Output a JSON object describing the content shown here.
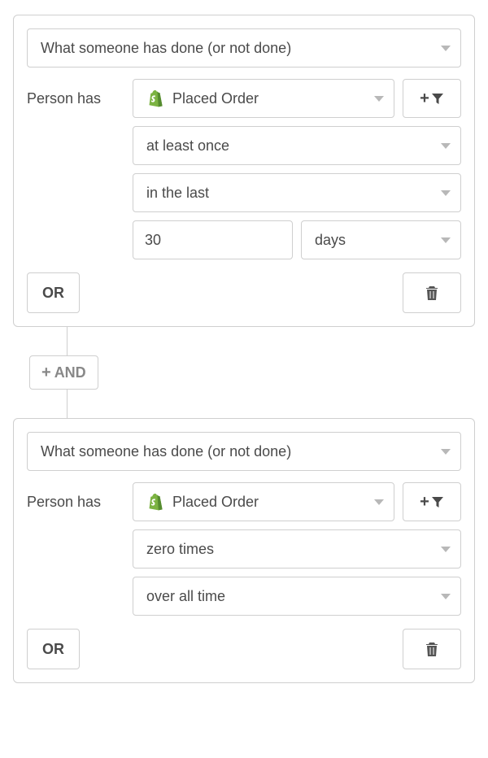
{
  "conditions": [
    {
      "type_label": "What someone has done (or not done)",
      "prefix": "Person has",
      "event": "Placed Order",
      "frequency": "at least once",
      "time_range": "in the last",
      "value": "30",
      "unit": "days",
      "or_label": "OR"
    },
    {
      "type_label": "What someone has done (or not done)",
      "prefix": "Person has",
      "event": "Placed Order",
      "frequency": "zero times",
      "time_range": "over all time",
      "or_label": "OR"
    }
  ],
  "and_label": "AND"
}
